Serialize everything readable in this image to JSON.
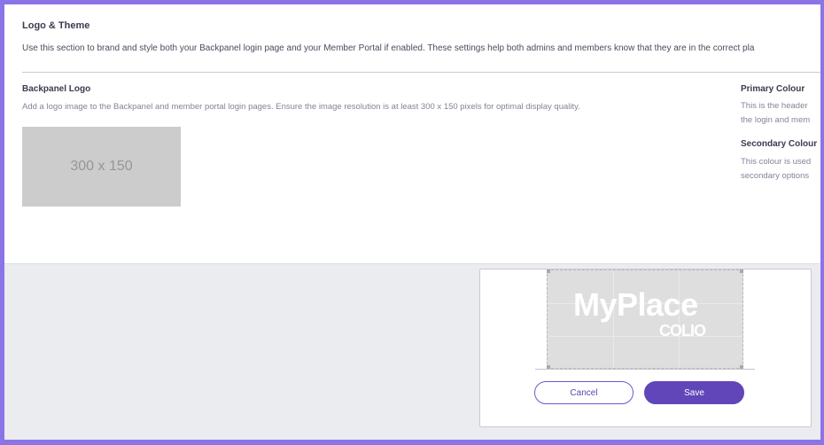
{
  "section": {
    "title": "Logo & Theme",
    "description": "Use this section to brand and style both your Backpanel login page and your Member Portal if enabled. These settings help both admins and members know that they are in the correct pla"
  },
  "backpanel_logo": {
    "title": "Backpanel Logo",
    "description": "Add a logo image to the Backpanel and member portal login pages. Ensure the image resolution is at least 300 x 150 pixels for optimal display quality.",
    "placeholder_text": "300 x 150"
  },
  "primary_colour": {
    "title": "Primary Colour",
    "description_line1": "This is the header",
    "description_line2": "the login and mem"
  },
  "secondary_colour": {
    "title": "Secondary Colour",
    "description_line1": "This colour is used",
    "description_line2": "secondary options"
  },
  "crop_modal": {
    "brand_main": "MyPlace",
    "brand_sub": "COLIO",
    "cancel_label": "Cancel",
    "save_label": "Save"
  },
  "colors": {
    "accent": "#6046b8",
    "frame": "#8b74e6",
    "placeholder": "#cccccc"
  }
}
